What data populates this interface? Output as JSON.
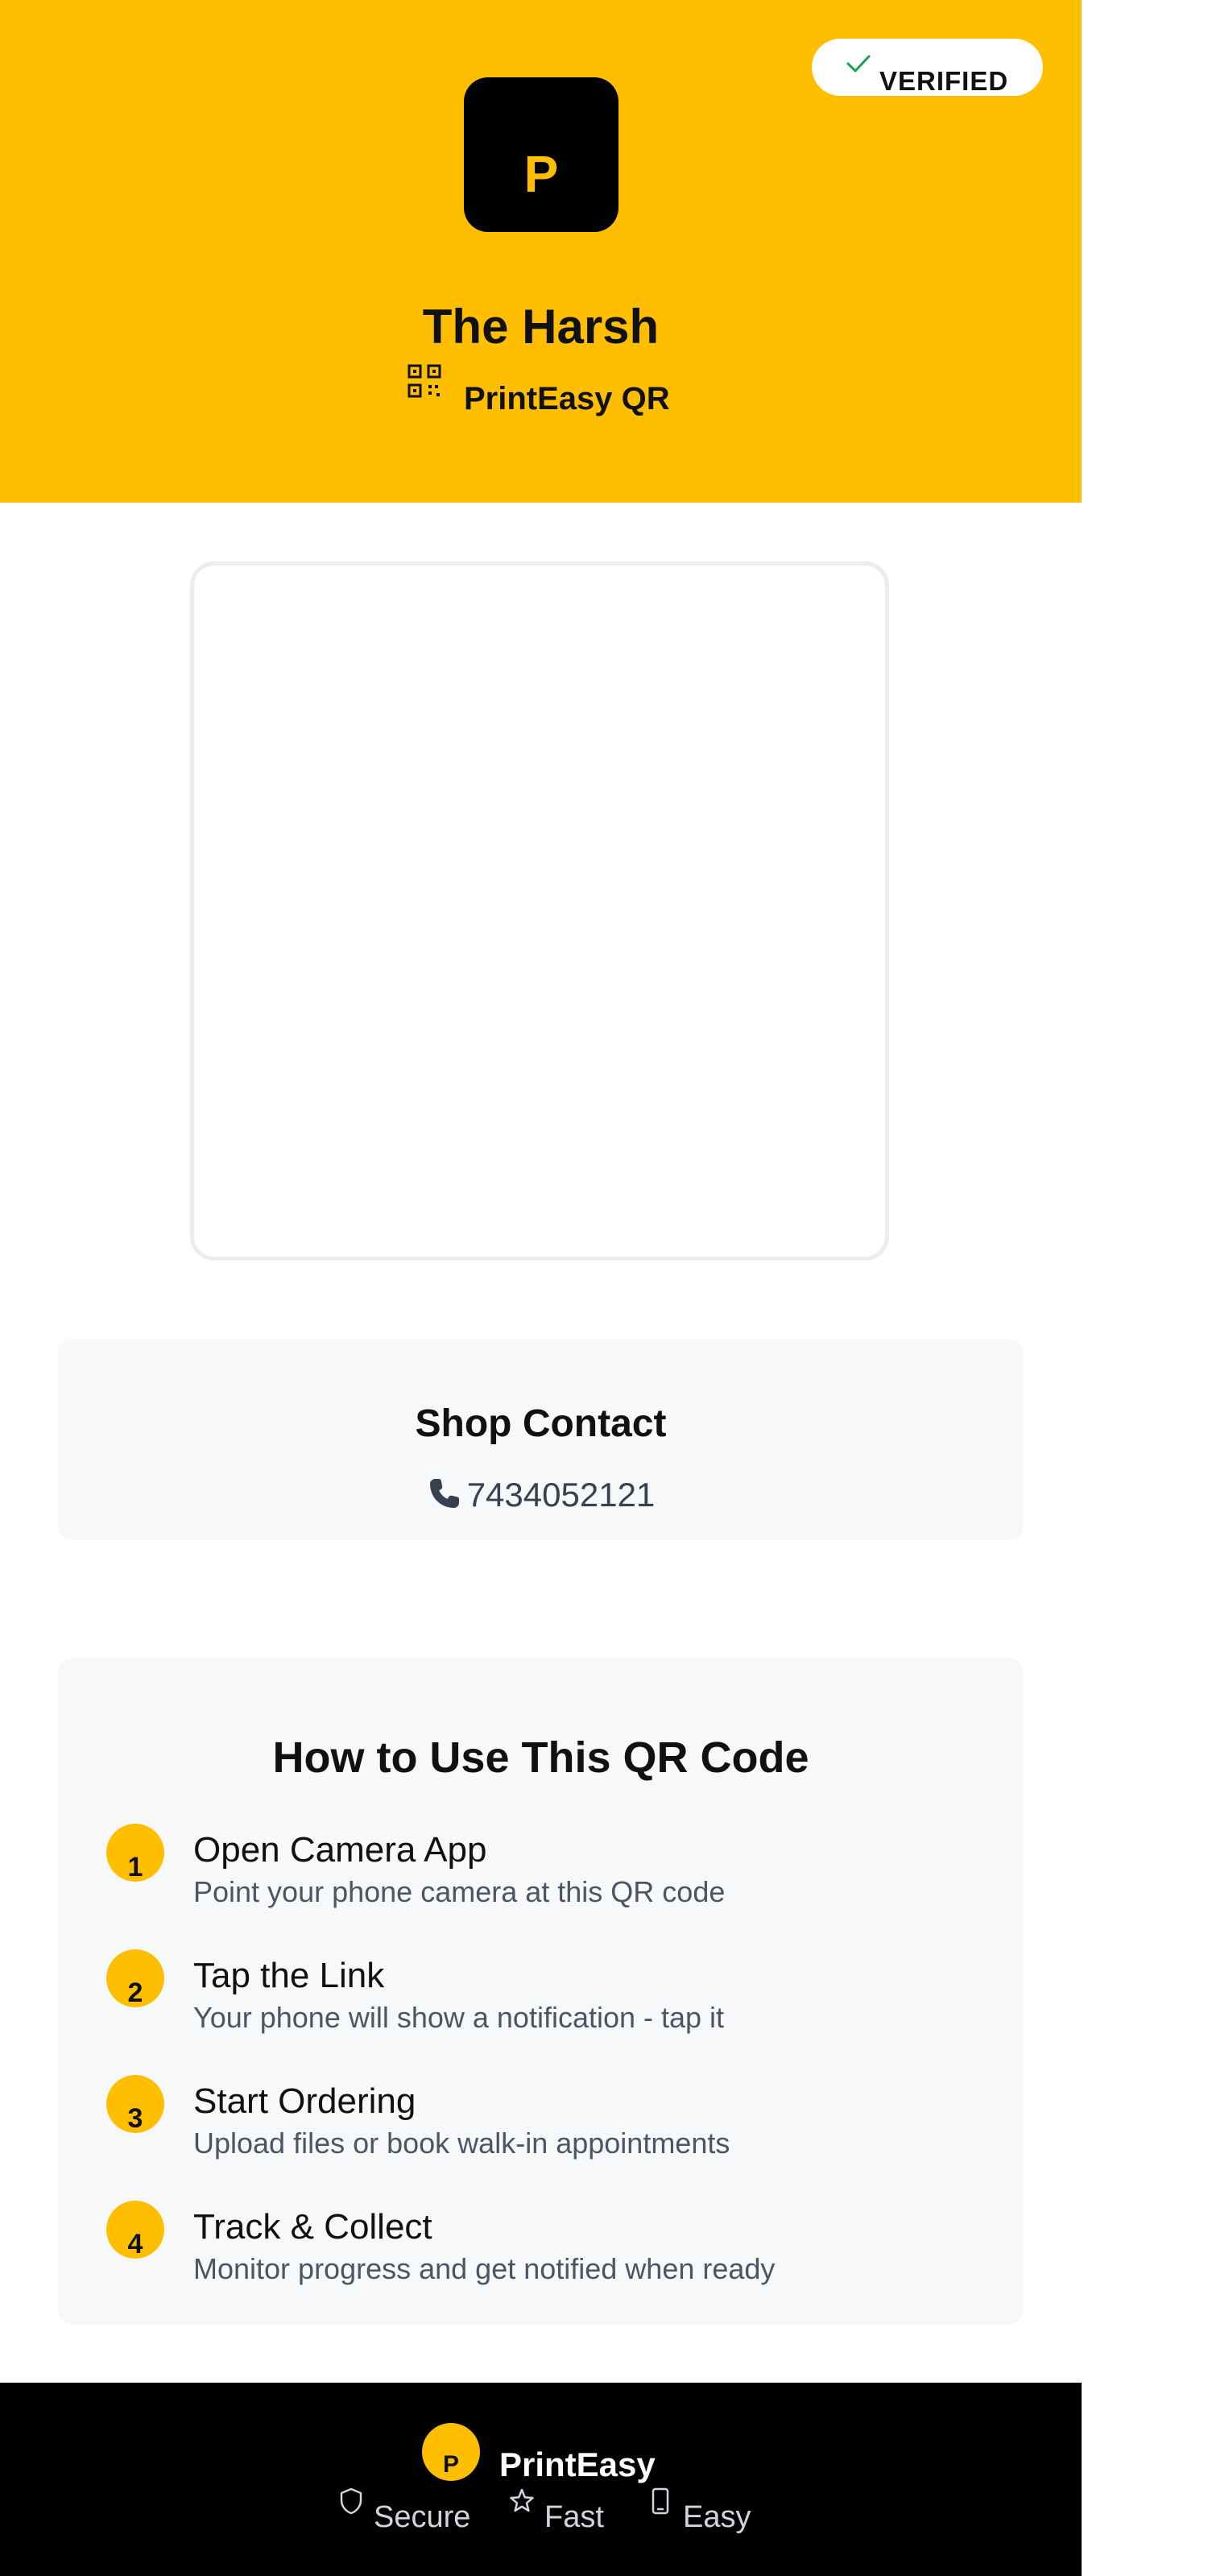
{
  "header": {
    "badge_label": "VERIFIED",
    "logo_letter": "P",
    "shop_name": "The Harsh",
    "brand_subtitle": "PrintEasy QR",
    "background_color": "#ffbf00"
  },
  "contact": {
    "title": "Shop Contact",
    "phone": "7434052121"
  },
  "howto": {
    "title": "How to Use This QR Code",
    "steps": [
      {
        "number": "1",
        "title": "Open Camera App",
        "description": "Point your phone camera at this QR code"
      },
      {
        "number": "2",
        "title": "Tap the Link",
        "description": "Your phone will show a notification - tap it"
      },
      {
        "number": "3",
        "title": "Start Ordering",
        "description": "Upload files or book walk-in appointments"
      },
      {
        "number": "4",
        "title": "Track & Collect",
        "description": "Monitor progress and get notified when ready"
      }
    ]
  },
  "footer": {
    "logo_letter": "P",
    "brand": "PrintEasy",
    "features": [
      {
        "icon": "shield-icon",
        "label": "Secure"
      },
      {
        "icon": "star-icon",
        "label": "Fast"
      },
      {
        "icon": "phone-device-icon",
        "label": "Easy"
      }
    ]
  },
  "colors": {
    "accent": "#ffbf00",
    "dark": "#000000",
    "card_background": "#f7f8fa",
    "check": "#16a34a"
  }
}
